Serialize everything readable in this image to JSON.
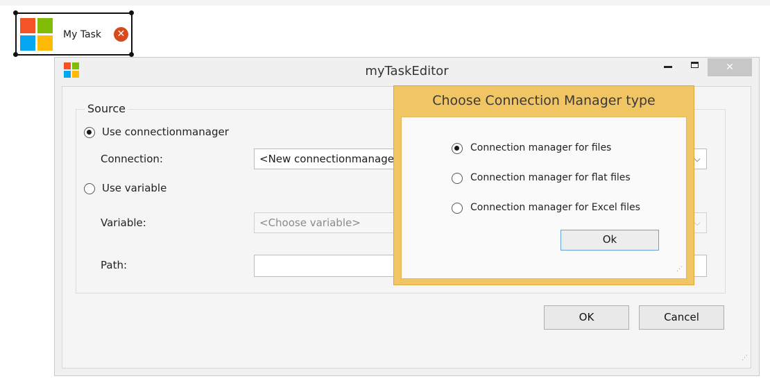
{
  "task": {
    "label": "My Task",
    "error_glyph": "✕",
    "icon": "windows-logo-icon"
  },
  "colors": {
    "logo_red": "#f35325",
    "logo_green": "#81bc06",
    "logo_blue": "#05a6f0",
    "logo_yellow": "#ffba08",
    "error": "#d84a1b",
    "dialog_accent": "#f1c564"
  },
  "editor": {
    "title": "myTaskEditor",
    "close_glyph": "✕",
    "source_group": "Source",
    "use_connection_label": "Use connectionmanager",
    "connection_label": "Connection:",
    "connection_value": "<New connectionmanager>",
    "use_variable_label": "Use variable",
    "variable_label": "Variable:",
    "variable_placeholder": "<Choose variable>",
    "path_label": "Path:",
    "path_value": "",
    "dropdown_glyph": "⌵",
    "ok_label": "OK",
    "cancel_label": "Cancel"
  },
  "cm_dialog": {
    "title": "Choose Connection Manager type",
    "options": [
      {
        "label": "Connection manager for files",
        "checked": true
      },
      {
        "label": "Connection manager for flat files",
        "checked": false
      },
      {
        "label": "Connection manager for Excel files",
        "checked": false
      }
    ],
    "ok_label": "Ok"
  }
}
